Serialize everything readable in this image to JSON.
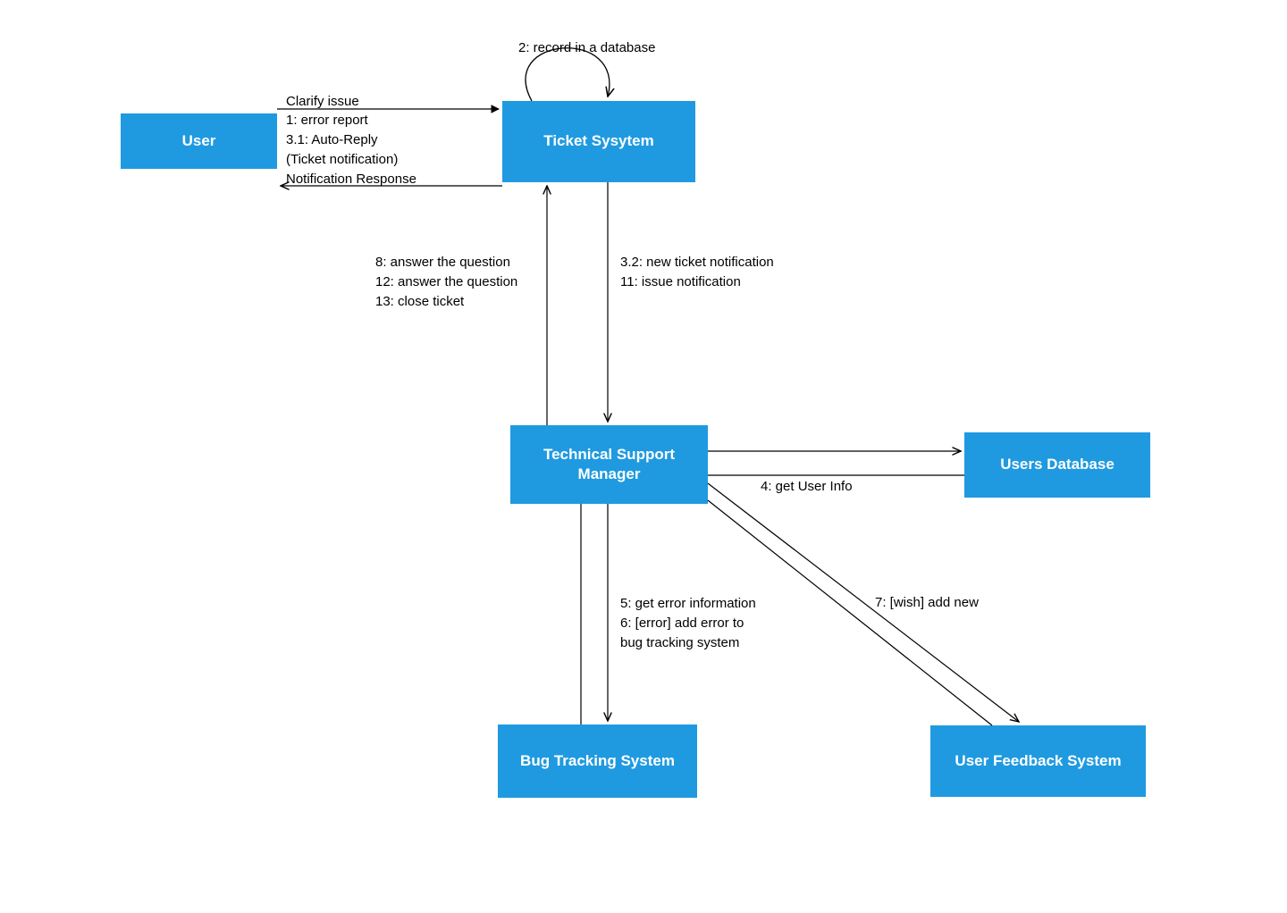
{
  "nodes": {
    "user": {
      "label": "User"
    },
    "ticket_system": {
      "label": "Ticket Sysytem"
    },
    "tech_support": {
      "label": "Technical Support Manager"
    },
    "users_db": {
      "label": "Users Database"
    },
    "bug_tracking": {
      "label": "Bug Tracking System"
    },
    "feedback": {
      "label": "User Feedback System"
    }
  },
  "edges": {
    "self_loop": {
      "label": "2: record in a database"
    },
    "clarify": {
      "label": "Clarify issue"
    },
    "error_report": {
      "label": "1: error report"
    },
    "auto_reply_1": {
      "label": "3.1: Auto-Reply"
    },
    "auto_reply_2": {
      "label": "(Ticket notification)"
    },
    "notification_response": {
      "label": "Notification Response"
    },
    "up_labels": {
      "l1": "8: answer the question",
      "l2": "12: answer the question",
      "l3": "13: close ticket"
    },
    "down_labels": {
      "l1": "3.2: new ticket notification",
      "l2": "11: issue notification"
    },
    "get_user_info": {
      "label": "4: get User Info"
    },
    "bug_labels": {
      "l1": "5: get error information",
      "l2": "6: [error] add error to",
      "l3": "bug tracking system"
    },
    "wish": {
      "label": "7: [wish] add new"
    }
  }
}
